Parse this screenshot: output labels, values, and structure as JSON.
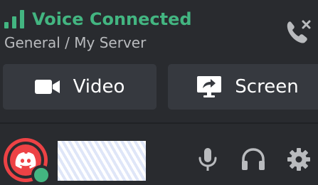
{
  "voice": {
    "status_label": "Voice Connected",
    "channel_path": "General / My Server",
    "status_color": "#43b581"
  },
  "actions": {
    "video_label": "Video",
    "screen_label": "Screen"
  },
  "user": {
    "status": "online",
    "status_color": "#43b581",
    "avatar_color": "#ed4245"
  },
  "icons": {
    "signal": "signal-bars-icon",
    "disconnect": "phone-hangup-icon",
    "video": "video-camera-icon",
    "screen": "screen-share-icon",
    "mic": "microphone-icon",
    "headset": "headphones-icon",
    "settings": "gear-icon",
    "avatar_logo": "discord-logo-icon"
  }
}
